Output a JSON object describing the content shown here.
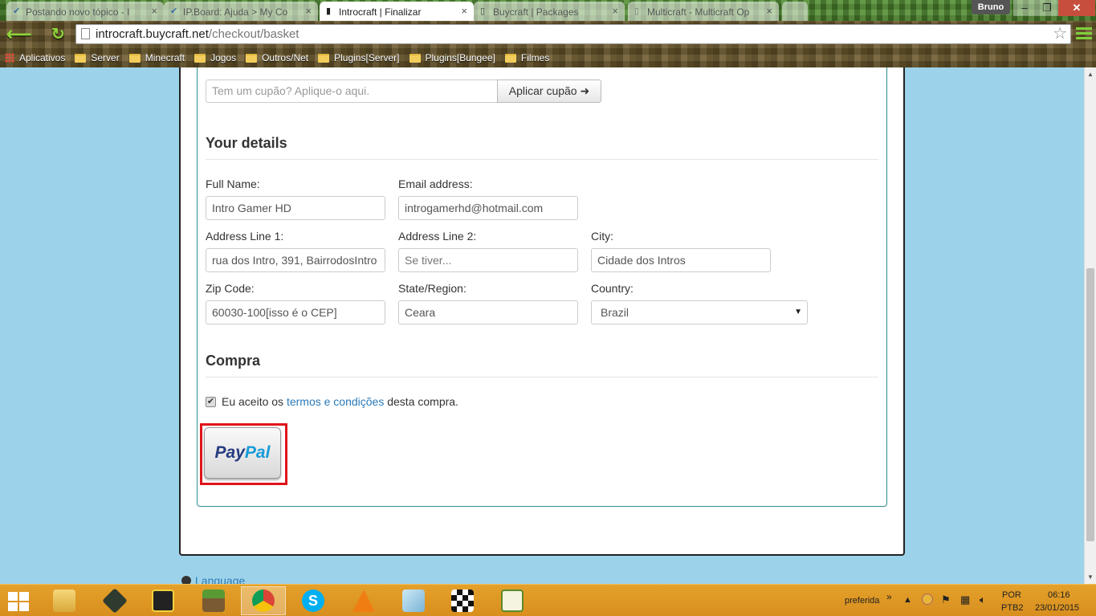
{
  "browser": {
    "tabs": [
      {
        "title": "Postando novo tópico - I",
        "icon": "forum-icon",
        "active": false
      },
      {
        "title": "IP.Board: Ajuda > My Co",
        "icon": "forum-icon",
        "active": false
      },
      {
        "title": "Introcraft | Finalizar",
        "icon": "buycraft-icon",
        "active": true
      },
      {
        "title": "Buycraft | Packages",
        "icon": "buycraft-icon",
        "active": false
      },
      {
        "title": "Multicraft - Multicraft Op",
        "icon": "page-icon",
        "active": false
      }
    ],
    "user": "Bruno",
    "window_buttons": {
      "minimize": "–",
      "restore": "❐",
      "close": "✕"
    },
    "url_domain": "introcraft.buycraft.net",
    "url_path": "/checkout/basket",
    "bookmarks": [
      {
        "label": "Aplicativos",
        "icon": "apps-icon"
      },
      {
        "label": "Server",
        "icon": "folder-icon"
      },
      {
        "label": "Minecraft",
        "icon": "folder-icon"
      },
      {
        "label": "Jogos",
        "icon": "folder-icon"
      },
      {
        "label": "Outros/Net",
        "icon": "folder-icon"
      },
      {
        "label": "Plugins[Server]",
        "icon": "folder-icon"
      },
      {
        "label": "Plugins[Bungee]",
        "icon": "folder-icon"
      },
      {
        "label": "Filmes",
        "icon": "folder-icon"
      }
    ]
  },
  "checkout": {
    "coupon": {
      "placeholder": "Tem um cupão? Aplique-o aqui.",
      "button": "Aplicar cupão ➜"
    },
    "details": {
      "title": "Your details",
      "full_name": {
        "label": "Full Name:",
        "value": "Intro Gamer HD"
      },
      "email": {
        "label": "Email address:",
        "value": "introgamerhd@hotmail.com"
      },
      "address1": {
        "label": "Address Line 1:",
        "value": "rua dos Intro, 391, BairrodosIntro"
      },
      "address2": {
        "label": "Address Line 2:",
        "value": "Se tiver..."
      },
      "city": {
        "label": "City:",
        "value": "Cidade dos Intros"
      },
      "zip": {
        "label": "Zip Code:",
        "value": "60030-100[isso é o CEP]"
      },
      "state": {
        "label": "State/Region:",
        "value": "Ceara"
      },
      "country": {
        "label": "Country:",
        "value": "Brazil"
      }
    },
    "purchase": {
      "title": "Compra",
      "terms_prefix": "Eu aceito os ",
      "terms_link": "termos e condições",
      "terms_suffix": " desta compra.",
      "terms_checked": true,
      "paypal_pay": "Pay",
      "paypal_pal": "Pal"
    },
    "language_link": "Language"
  },
  "taskbar": {
    "apps": [
      "file-explorer-icon",
      "terminal-icon",
      "stats-icon",
      "minecraft-icon",
      "chrome-icon",
      "skype-icon",
      "vlc-icon",
      "notepad-icon",
      "app-icon",
      "editor-icon"
    ],
    "tray_label": "preferida",
    "lang_top": "POR",
    "lang_bottom": "PTB2",
    "time": "06:16",
    "date": "23/01/2015"
  },
  "colors": {
    "accent_link": "#2a7ab8",
    "highlight_frame": "#e0141b",
    "taskbar": "#e4a12a",
    "page_bg": "#9dd3ea"
  }
}
